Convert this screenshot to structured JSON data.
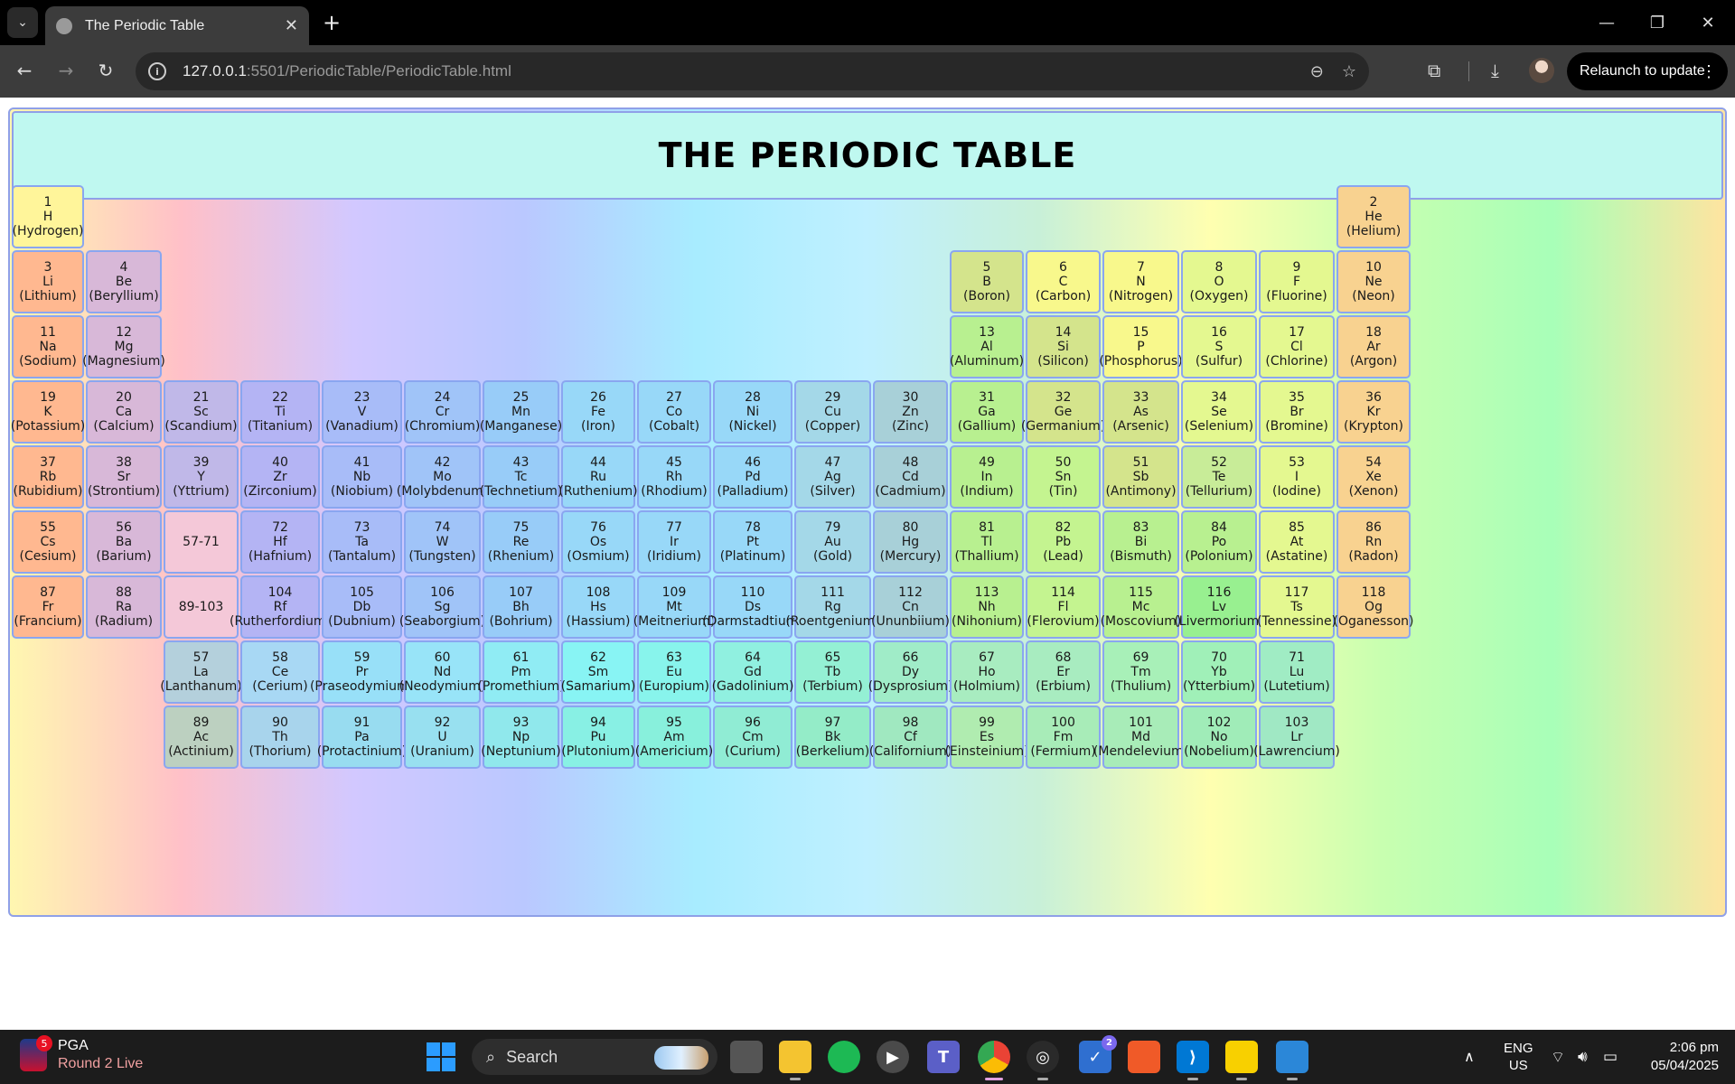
{
  "browser": {
    "tab_title": "The Periodic Table",
    "url_host": "127.0.0.1",
    "url_rest": ":5501/PeriodicTable/PeriodicTable.html",
    "relaunch_label": "Relaunch to update"
  },
  "page": {
    "title": "THE PERIODIC TABLE"
  },
  "elements": [
    {
      "n": "1",
      "s": "H",
      "name": "(Hydrogen)",
      "col": 1,
      "row": 1,
      "color": "#fff59a"
    },
    {
      "n": "2",
      "s": "He",
      "name": "(Helium)",
      "col": 18,
      "row": 1,
      "color": "#f8d290"
    },
    {
      "n": "3",
      "s": "Li",
      "name": "(Lithium)",
      "col": 1,
      "row": 2,
      "color": "#ffb890"
    },
    {
      "n": "4",
      "s": "Be",
      "name": "(Beryllium)",
      "col": 2,
      "row": 2,
      "color": "#d8b8d8"
    },
    {
      "n": "5",
      "s": "B",
      "name": "(Boron)",
      "col": 13,
      "row": 2,
      "color": "#d4e48c"
    },
    {
      "n": "6",
      "s": "C",
      "name": "(Carbon)",
      "col": 14,
      "row": 2,
      "color": "#f8f88c"
    },
    {
      "n": "7",
      "s": "N",
      "name": "(Nitrogen)",
      "col": 15,
      "row": 2,
      "color": "#f8f88c"
    },
    {
      "n": "8",
      "s": "O",
      "name": "(Oxygen)",
      "col": 16,
      "row": 2,
      "color": "#e4f890"
    },
    {
      "n": "9",
      "s": "F",
      "name": "(Fluorine)",
      "col": 17,
      "row": 2,
      "color": "#e4f890"
    },
    {
      "n": "10",
      "s": "Ne",
      "name": "(Neon)",
      "col": 18,
      "row": 2,
      "color": "#f8d290"
    },
    {
      "n": "11",
      "s": "Na",
      "name": "(Sodium)",
      "col": 1,
      "row": 3,
      "color": "#ffb890"
    },
    {
      "n": "12",
      "s": "Mg",
      "name": "(Magnesium)",
      "col": 2,
      "row": 3,
      "color": "#d8b8d8"
    },
    {
      "n": "13",
      "s": "Al",
      "name": "(Aluminum)",
      "col": 13,
      "row": 3,
      "color": "#b8f090"
    },
    {
      "n": "14",
      "s": "Si",
      "name": "(Silicon)",
      "col": 14,
      "row": 3,
      "color": "#d4e48c"
    },
    {
      "n": "15",
      "s": "P",
      "name": "(Phosphorus)",
      "col": 15,
      "row": 3,
      "color": "#f8f88c"
    },
    {
      "n": "16",
      "s": "S",
      "name": "(Sulfur)",
      "col": 16,
      "row": 3,
      "color": "#e4f890"
    },
    {
      "n": "17",
      "s": "Cl",
      "name": "(Chlorine)",
      "col": 17,
      "row": 3,
      "color": "#e4f890"
    },
    {
      "n": "18",
      "s": "Ar",
      "name": "(Argon)",
      "col": 18,
      "row": 3,
      "color": "#f8d290"
    },
    {
      "n": "19",
      "s": "K",
      "name": "(Potassium)",
      "col": 1,
      "row": 4,
      "color": "#ffb890"
    },
    {
      "n": "20",
      "s": "Ca",
      "name": "(Calcium)",
      "col": 2,
      "row": 4,
      "color": "#d8b8d8"
    },
    {
      "n": "21",
      "s": "Sc",
      "name": "(Scandium)",
      "col": 3,
      "row": 4,
      "color": "#c0b8e8"
    },
    {
      "n": "22",
      "s": "Ti",
      "name": "(Titanium)",
      "col": 4,
      "row": 4,
      "color": "#b4b4f4"
    },
    {
      "n": "23",
      "s": "V",
      "name": "(Vanadium)",
      "col": 5,
      "row": 4,
      "color": "#a8bcf8"
    },
    {
      "n": "24",
      "s": "Cr",
      "name": "(Chromium)",
      "col": 6,
      "row": 4,
      "color": "#a0c4f8"
    },
    {
      "n": "25",
      "s": "Mn",
      "name": "(Manganese)",
      "col": 7,
      "row": 4,
      "color": "#98ccf8"
    },
    {
      "n": "26",
      "s": "Fe",
      "name": "(Iron)",
      "col": 8,
      "row": 4,
      "color": "#98d8f8"
    },
    {
      "n": "27",
      "s": "Co",
      "name": "(Cobalt)",
      "col": 9,
      "row": 4,
      "color": "#98d8f8"
    },
    {
      "n": "28",
      "s": "Ni",
      "name": "(Nickel)",
      "col": 10,
      "row": 4,
      "color": "#98d8f8"
    },
    {
      "n": "29",
      "s": "Cu",
      "name": "(Copper)",
      "col": 11,
      "row": 4,
      "color": "#a4d8e8"
    },
    {
      "n": "30",
      "s": "Zn",
      "name": "(Zinc)",
      "col": 12,
      "row": 4,
      "color": "#a8d0d8"
    },
    {
      "n": "31",
      "s": "Ga",
      "name": "(Gallium)",
      "col": 13,
      "row": 4,
      "color": "#b8f090"
    },
    {
      "n": "32",
      "s": "Ge",
      "name": "(Germanium)",
      "col": 14,
      "row": 4,
      "color": "#d4e48c"
    },
    {
      "n": "33",
      "s": "As",
      "name": "(Arsenic)",
      "col": 15,
      "row": 4,
      "color": "#d4e48c"
    },
    {
      "n": "34",
      "s": "Se",
      "name": "(Selenium)",
      "col": 16,
      "row": 4,
      "color": "#e4f890"
    },
    {
      "n": "35",
      "s": "Br",
      "name": "(Bromine)",
      "col": 17,
      "row": 4,
      "color": "#e4f890"
    },
    {
      "n": "36",
      "s": "Kr",
      "name": "(Krypton)",
      "col": 18,
      "row": 4,
      "color": "#f8d290"
    },
    {
      "n": "37",
      "s": "Rb",
      "name": "(Rubidium)",
      "col": 1,
      "row": 5,
      "color": "#ffb890"
    },
    {
      "n": "38",
      "s": "Sr",
      "name": "(Strontium)",
      "col": 2,
      "row": 5,
      "color": "#d8b8d8"
    },
    {
      "n": "39",
      "s": "Y",
      "name": "(Yttrium)",
      "col": 3,
      "row": 5,
      "color": "#c0b8e8"
    },
    {
      "n": "40",
      "s": "Zr",
      "name": "(Zirconium)",
      "col": 4,
      "row": 5,
      "color": "#b4b4f4"
    },
    {
      "n": "41",
      "s": "Nb",
      "name": "(Niobium)",
      "col": 5,
      "row": 5,
      "color": "#a8bcf8"
    },
    {
      "n": "42",
      "s": "Mo",
      "name": "(Molybdenum)",
      "col": 6,
      "row": 5,
      "color": "#a0c4f8"
    },
    {
      "n": "43",
      "s": "Tc",
      "name": "(Technetium)",
      "col": 7,
      "row": 5,
      "color": "#98ccf8"
    },
    {
      "n": "44",
      "s": "Ru",
      "name": "(Ruthenium)",
      "col": 8,
      "row": 5,
      "color": "#98d8f8"
    },
    {
      "n": "45",
      "s": "Rh",
      "name": "(Rhodium)",
      "col": 9,
      "row": 5,
      "color": "#98d8f8"
    },
    {
      "n": "46",
      "s": "Pd",
      "name": "(Palladium)",
      "col": 10,
      "row": 5,
      "color": "#98d8f8"
    },
    {
      "n": "47",
      "s": "Ag",
      "name": "(Silver)",
      "col": 11,
      "row": 5,
      "color": "#a4d8e8"
    },
    {
      "n": "48",
      "s": "Cd",
      "name": "(Cadmium)",
      "col": 12,
      "row": 5,
      "color": "#a8d0d8"
    },
    {
      "n": "49",
      "s": "In",
      "name": "(Indium)",
      "col": 13,
      "row": 5,
      "color": "#b8f090"
    },
    {
      "n": "50",
      "s": "Sn",
      "name": "(Tin)",
      "col": 14,
      "row": 5,
      "color": "#c4f490"
    },
    {
      "n": "51",
      "s": "Sb",
      "name": "(Antimony)",
      "col": 15,
      "row": 5,
      "color": "#d4e48c"
    },
    {
      "n": "52",
      "s": "Te",
      "name": "(Tellurium)",
      "col": 16,
      "row": 5,
      "color": "#c8ec98"
    },
    {
      "n": "53",
      "s": "I",
      "name": "(Iodine)",
      "col": 17,
      "row": 5,
      "color": "#e4f890"
    },
    {
      "n": "54",
      "s": "Xe",
      "name": "(Xenon)",
      "col": 18,
      "row": 5,
      "color": "#f8d290"
    },
    {
      "n": "55",
      "s": "Cs",
      "name": "(Cesium)",
      "col": 1,
      "row": 6,
      "color": "#ffb890"
    },
    {
      "n": "56",
      "s": "Ba",
      "name": "(Barium)",
      "col": 2,
      "row": 6,
      "color": "#d8b8d8"
    },
    {
      "n": "",
      "s": "57-71",
      "name": "",
      "col": 3,
      "row": 6,
      "color": "#f4c8d8"
    },
    {
      "n": "72",
      "s": "Hf",
      "name": "(Hafnium)",
      "col": 4,
      "row": 6,
      "color": "#b4b4f4"
    },
    {
      "n": "73",
      "s": "Ta",
      "name": "(Tantalum)",
      "col": 5,
      "row": 6,
      "color": "#a8bcf8"
    },
    {
      "n": "74",
      "s": "W",
      "name": "(Tungsten)",
      "col": 6,
      "row": 6,
      "color": "#a0c4f8"
    },
    {
      "n": "75",
      "s": "Re",
      "name": "(Rhenium)",
      "col": 7,
      "row": 6,
      "color": "#98ccf8"
    },
    {
      "n": "76",
      "s": "Os",
      "name": "(Osmium)",
      "col": 8,
      "row": 6,
      "color": "#98d8f8"
    },
    {
      "n": "77",
      "s": "Ir",
      "name": "(Iridium)",
      "col": 9,
      "row": 6,
      "color": "#98d8f8"
    },
    {
      "n": "78",
      "s": "Pt",
      "name": "(Platinum)",
      "col": 10,
      "row": 6,
      "color": "#98d8f8"
    },
    {
      "n": "79",
      "s": "Au",
      "name": "(Gold)",
      "col": 11,
      "row": 6,
      "color": "#a4d8e8"
    },
    {
      "n": "80",
      "s": "Hg",
      "name": "(Mercury)",
      "col": 12,
      "row": 6,
      "color": "#a8d0d8"
    },
    {
      "n": "81",
      "s": "Tl",
      "name": "(Thallium)",
      "col": 13,
      "row": 6,
      "color": "#b8f090"
    },
    {
      "n": "82",
      "s": "Pb",
      "name": "(Lead)",
      "col": 14,
      "row": 6,
      "color": "#c4f490"
    },
    {
      "n": "83",
      "s": "Bi",
      "name": "(Bismuth)",
      "col": 15,
      "row": 6,
      "color": "#b8f090"
    },
    {
      "n": "84",
      "s": "Po",
      "name": "(Polonium)",
      "col": 16,
      "row": 6,
      "color": "#b8f090"
    },
    {
      "n": "85",
      "s": "At",
      "name": "(Astatine)",
      "col": 17,
      "row": 6,
      "color": "#e4f890"
    },
    {
      "n": "86",
      "s": "Rn",
      "name": "(Radon)",
      "col": 18,
      "row": 6,
      "color": "#f8d290"
    },
    {
      "n": "87",
      "s": "Fr",
      "name": "(Francium)",
      "col": 1,
      "row": 7,
      "color": "#ffb890"
    },
    {
      "n": "88",
      "s": "Ra",
      "name": "(Radium)",
      "col": 2,
      "row": 7,
      "color": "#d8b8d8"
    },
    {
      "n": "",
      "s": "89-103",
      "name": "",
      "col": 3,
      "row": 7,
      "color": "#f4c8d8"
    },
    {
      "n": "104",
      "s": "Rf",
      "name": "(Rutherfordium)",
      "col": 4,
      "row": 7,
      "color": "#b4b4f4"
    },
    {
      "n": "105",
      "s": "Db",
      "name": "(Dubnium)",
      "col": 5,
      "row": 7,
      "color": "#a8bcf8"
    },
    {
      "n": "106",
      "s": "Sg",
      "name": "(Seaborgium)",
      "col": 6,
      "row": 7,
      "color": "#a0c4f8"
    },
    {
      "n": "107",
      "s": "Bh",
      "name": "(Bohrium)",
      "col": 7,
      "row": 7,
      "color": "#98ccf8"
    },
    {
      "n": "108",
      "s": "Hs",
      "name": "(Hassium)",
      "col": 8,
      "row": 7,
      "color": "#98d8f8"
    },
    {
      "n": "109",
      "s": "Mt",
      "name": "(Meitnerium)",
      "col": 9,
      "row": 7,
      "color": "#98d8f8"
    },
    {
      "n": "110",
      "s": "Ds",
      "name": "(Darmstadtium)",
      "col": 10,
      "row": 7,
      "color": "#98d8f8"
    },
    {
      "n": "111",
      "s": "Rg",
      "name": "(Roentgenium)",
      "col": 11,
      "row": 7,
      "color": "#a4d8e8"
    },
    {
      "n": "112",
      "s": "Cn",
      "name": "(Ununbiium)",
      "col": 12,
      "row": 7,
      "color": "#a8d0d8"
    },
    {
      "n": "113",
      "s": "Nh",
      "name": "(Nihonium)",
      "col": 13,
      "row": 7,
      "color": "#b8f090"
    },
    {
      "n": "114",
      "s": "Fl",
      "name": "(Flerovium)",
      "col": 14,
      "row": 7,
      "color": "#c4f490"
    },
    {
      "n": "115",
      "s": "Mc",
      "name": "(Moscovium)",
      "col": 15,
      "row": 7,
      "color": "#b8f090"
    },
    {
      "n": "116",
      "s": "Lv",
      "name": "(Livermorium)",
      "col": 16,
      "row": 7,
      "color": "#98f090"
    },
    {
      "n": "117",
      "s": "Ts",
      "name": "(Tennessine)",
      "col": 17,
      "row": 7,
      "color": "#e4f890"
    },
    {
      "n": "118",
      "s": "Og",
      "name": "(Oganesson)",
      "col": 18,
      "row": 7,
      "color": "#f8d290"
    },
    {
      "n": "57",
      "s": "La",
      "name": "(Lanthanum)",
      "col": 3,
      "row": 8,
      "color": "#b4d0dc"
    },
    {
      "n": "58",
      "s": "Ce",
      "name": "(Cerium)",
      "col": 4,
      "row": 8,
      "color": "#a8d8f4"
    },
    {
      "n": "59",
      "s": "Pr",
      "name": "(Praseodymium)",
      "col": 5,
      "row": 8,
      "color": "#98e0f8"
    },
    {
      "n": "60",
      "s": "Nd",
      "name": "(Neodymium)",
      "col": 6,
      "row": 8,
      "color": "#98e4f8"
    },
    {
      "n": "61",
      "s": "Pm",
      "name": "(Promethium)",
      "col": 7,
      "row": 8,
      "color": "#90ecf4"
    },
    {
      "n": "62",
      "s": "Sm",
      "name": "(Samarium)",
      "col": 8,
      "row": 8,
      "color": "#88f4f4"
    },
    {
      "n": "63",
      "s": "Eu",
      "name": "(Europium)",
      "col": 9,
      "row": 8,
      "color": "#88f4ec"
    },
    {
      "n": "64",
      "s": "Gd",
      "name": "(Gadolinium)",
      "col": 10,
      "row": 8,
      "color": "#90f0e0"
    },
    {
      "n": "65",
      "s": "Tb",
      "name": "(Terbium)",
      "col": 11,
      "row": 8,
      "color": "#94f0d4"
    },
    {
      "n": "66",
      "s": "Dy",
      "name": "(Dysprosium)",
      "col": 12,
      "row": 8,
      "color": "#a0ecc8"
    },
    {
      "n": "67",
      "s": "Ho",
      "name": "(Holmium)",
      "col": 13,
      "row": 8,
      "color": "#a8ecc0"
    },
    {
      "n": "68",
      "s": "Er",
      "name": "(Erbium)",
      "col": 14,
      "row": 8,
      "color": "#a8ecc0"
    },
    {
      "n": "69",
      "s": "Tm",
      "name": "(Thulium)",
      "col": 15,
      "row": 8,
      "color": "#a8f0b8"
    },
    {
      "n": "70",
      "s": "Yb",
      "name": "(Ytterbium)",
      "col": 16,
      "row": 8,
      "color": "#a0f0b8"
    },
    {
      "n": "71",
      "s": "Lu",
      "name": "(Lutetium)",
      "col": 17,
      "row": 8,
      "color": "#a0ecc4"
    },
    {
      "n": "89",
      "s": "Ac",
      "name": "(Actinium)",
      "col": 3,
      "row": 9,
      "color": "#bcd0c0"
    },
    {
      "n": "90",
      "s": "Th",
      "name": "(Thorium)",
      "col": 4,
      "row": 9,
      "color": "#a8d4ec"
    },
    {
      "n": "91",
      "s": "Pa",
      "name": "(Protactinium)",
      "col": 5,
      "row": 9,
      "color": "#98dcf0"
    },
    {
      "n": "92",
      "s": "U",
      "name": "(Uranium)",
      "col": 6,
      "row": 9,
      "color": "#98e0f0"
    },
    {
      "n": "93",
      "s": "Np",
      "name": "(Neptunium)",
      "col": 7,
      "row": 9,
      "color": "#90e8ec"
    },
    {
      "n": "94",
      "s": "Pu",
      "name": "(Plutonium)",
      "col": 8,
      "row": 9,
      "color": "#88f0e4"
    },
    {
      "n": "95",
      "s": "Am",
      "name": "(Americium)",
      "col": 9,
      "row": 9,
      "color": "#88f0dc"
    },
    {
      "n": "96",
      "s": "Cm",
      "name": "(Curium)",
      "col": 10,
      "row": 9,
      "color": "#90ecd4"
    },
    {
      "n": "97",
      "s": "Bk",
      "name": "(Berkelium)",
      "col": 11,
      "row": 9,
      "color": "#94ecc8"
    },
    {
      "n": "98",
      "s": "Cf",
      "name": "(Californium)",
      "col": 12,
      "row": 9,
      "color": "#a0e8c0"
    },
    {
      "n": "99",
      "s": "Es",
      "name": "(Einsteinium)",
      "col": 13,
      "row": 9,
      "color": "#b0ecb0"
    },
    {
      "n": "100",
      "s": "Fm",
      "name": "(Fermium)",
      "col": 14,
      "row": 9,
      "color": "#a8ecb8"
    },
    {
      "n": "101",
      "s": "Md",
      "name": "(Mendelevium)",
      "col": 15,
      "row": 9,
      "color": "#a8ecb8"
    },
    {
      "n": "102",
      "s": "No",
      "name": "(Nobelium)",
      "col": 16,
      "row": 9,
      "color": "#a0ecb8"
    },
    {
      "n": "103",
      "s": "Lr",
      "name": "(Lawrencium)",
      "col": 17,
      "row": 9,
      "color": "#a0e8c4"
    }
  ],
  "taskbar": {
    "news_badge": "5",
    "news_title": "PGA",
    "news_sub": "Round 2 Live",
    "search_label": "Search",
    "lang1": "ENG",
    "lang2": "US",
    "time": "2:06 pm",
    "date": "05/04/2025",
    "todo_badge": "2"
  }
}
